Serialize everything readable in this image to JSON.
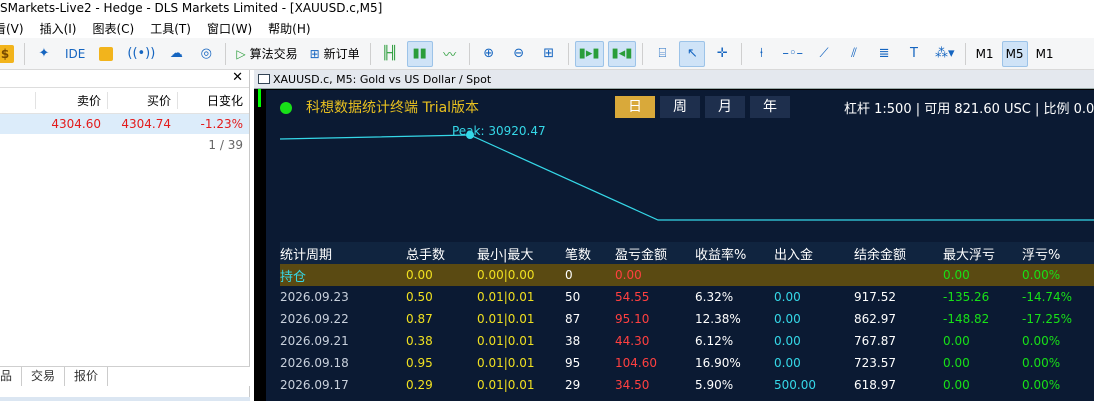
{
  "window": {
    "title": "SMarkets-Live2 - Hedge - DLS Markets Limited - [XAUUSD.c,M5]"
  },
  "menu": [
    "看(V)",
    "插入(I)",
    "图表(C)",
    "工具(T)",
    "窗口(W)",
    "帮助(H)"
  ],
  "toolbar": {
    "ide_label": "IDE",
    "algo_trading_label": "算法交易",
    "new_order_label": "新订单",
    "timeframes": [
      "M1",
      "M5",
      "M1"
    ],
    "active_timeframe": "M5"
  },
  "market_watch": {
    "columns": [
      "卖价",
      "买价",
      "日变化"
    ],
    "rows": [
      {
        "bid": "4304.60",
        "ask": "4304.74",
        "change": "-1.23%"
      }
    ],
    "pager": "1 / 39",
    "tabs": [
      "品",
      "交易",
      "报价"
    ]
  },
  "chart_window": {
    "title": "XAUUSD.c, M5:  Gold vs US Dollar / Spot"
  },
  "panel": {
    "app_title": "科想数据统计终端 Trial版本",
    "periods": [
      "日",
      "周",
      "月",
      "年"
    ],
    "selected_period": "日",
    "account_info": "杠杆 1:500 | 可用 821.60 USC | 比例 0.0",
    "peak_label": "Peak: 30920.47",
    "colors": {
      "bg": "#0b1a33",
      "accent": "#d9a93a",
      "curve": "#35d8e8",
      "title": "#e8c020"
    },
    "table": {
      "headers": [
        "统计周期",
        "总手数",
        "最小|最大",
        "笔数",
        "盈亏金额",
        "收益率%",
        "出入金",
        "结余金额",
        "最大浮亏",
        "浮亏%"
      ],
      "holding": {
        "label": "持仓",
        "lots": "0.00",
        "minmax": "0.00|0.00",
        "count": "0",
        "pnl": "0.00",
        "float_loss": "0.00",
        "float_pct": "0.00%"
      },
      "rows": [
        {
          "date": "2026.09.23",
          "lots": "0.50",
          "minmax": "0.01|0.01",
          "count": "50",
          "pnl": "54.55",
          "rate": "6.32%",
          "io": "0.00",
          "balance": "917.52",
          "max_float": "-135.26",
          "float_pct": "-14.74%"
        },
        {
          "date": "2026.09.22",
          "lots": "0.87",
          "minmax": "0.01|0.01",
          "count": "87",
          "pnl": "95.10",
          "rate": "12.38%",
          "io": "0.00",
          "balance": "862.97",
          "max_float": "-148.82",
          "float_pct": "-17.25%"
        },
        {
          "date": "2026.09.21",
          "lots": "0.38",
          "minmax": "0.01|0.01",
          "count": "38",
          "pnl": "44.30",
          "rate": "6.12%",
          "io": "0.00",
          "balance": "767.87",
          "max_float": "0.00",
          "float_pct": "0.00%"
        },
        {
          "date": "2026.09.18",
          "lots": "0.95",
          "minmax": "0.01|0.01",
          "count": "95",
          "pnl": "104.60",
          "rate": "16.90%",
          "io": "0.00",
          "balance": "723.57",
          "max_float": "0.00",
          "float_pct": "0.00%"
        },
        {
          "date": "2026.09.17",
          "lots": "0.29",
          "minmax": "0.01|0.01",
          "count": "29",
          "pnl": "34.50",
          "rate": "5.90%",
          "io": "500.00",
          "balance": "618.97",
          "max_float": "0.00",
          "float_pct": "0.00%"
        }
      ]
    }
  }
}
